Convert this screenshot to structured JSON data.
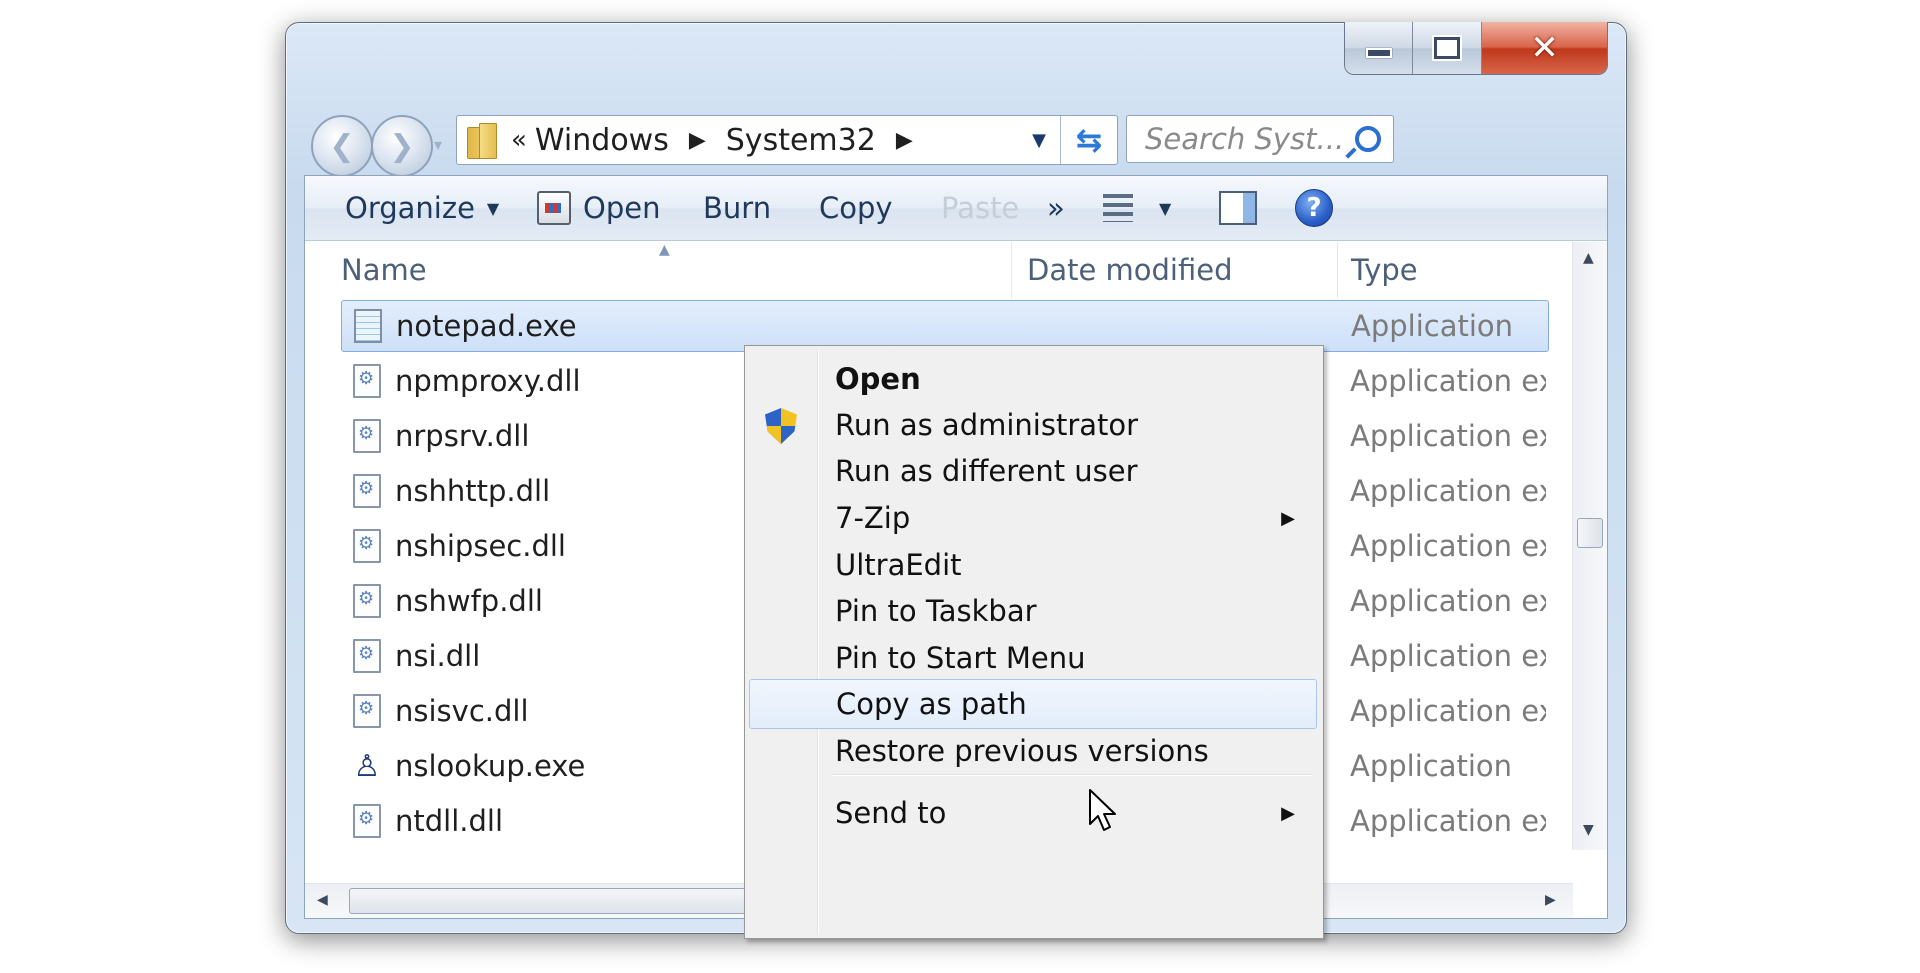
{
  "window": {
    "caption_buttons": {
      "close_glyph": "✕"
    }
  },
  "navigation": {
    "back_glyph": "❮",
    "forward_glyph": "❯",
    "history_glyph": "▾"
  },
  "address_bar": {
    "overflow_glyph": "«",
    "crumbs": [
      "Windows",
      "System32"
    ],
    "crumb_chevron": "▶",
    "dropdown_glyph": "▼",
    "refresh_glyph": "⇆"
  },
  "search": {
    "placeholder": "Search Syst..."
  },
  "toolbar": {
    "organize": "Organize",
    "open": "Open",
    "burn": "Burn",
    "copy": "Copy",
    "paste": "Paste",
    "more": "»",
    "dropdown_glyph": "▼",
    "help_glyph": "?"
  },
  "columns": {
    "name": "Name",
    "date_modified": "Date modified",
    "type": "Type",
    "sort_glyph": "▲"
  },
  "files": [
    {
      "name": "notepad.exe",
      "type": "Application",
      "icon": "notepad-icon",
      "selected": true
    },
    {
      "name": "npmproxy.dll",
      "type": "Application exte",
      "icon": "dll-file-icon"
    },
    {
      "name": "nrpsrv.dll",
      "type": "Application exte",
      "icon": "dll-file-icon"
    },
    {
      "name": "nshhttp.dll",
      "type": "Application exte",
      "icon": "dll-file-icon"
    },
    {
      "name": "nshipsec.dll",
      "type": "Application exte",
      "icon": "dll-file-icon"
    },
    {
      "name": "nshwfp.dll",
      "type": "Application exte",
      "icon": "dll-file-icon"
    },
    {
      "name": "nsi.dll",
      "type": "Application exte",
      "icon": "dll-file-icon"
    },
    {
      "name": "nsisvc.dll",
      "type": "Application exte",
      "icon": "dll-file-icon"
    },
    {
      "name": "nslookup.exe",
      "type": "Application",
      "icon": "network-app-icon"
    },
    {
      "name": "ntdll.dll",
      "type": "Application exte",
      "icon": "dll-file-icon"
    }
  ],
  "scrollbars": {
    "up_glyph": "▲",
    "down_glyph": "▼",
    "left_glyph": "◀",
    "right_glyph": "▶"
  },
  "context_menu": {
    "items": [
      {
        "label": "Open",
        "bold": true
      },
      {
        "label": "Run as administrator",
        "icon": "uac-shield-icon"
      },
      {
        "label": "Run as different user"
      },
      {
        "label": "7-Zip",
        "submenu": true
      },
      {
        "label": "UltraEdit"
      },
      {
        "label": "Pin to Taskbar"
      },
      {
        "label": "Pin to Start Menu"
      },
      {
        "label": "Copy as path",
        "hovered": true
      },
      {
        "label": "Restore previous versions"
      },
      {
        "label": "Send to",
        "submenu": true
      }
    ],
    "submenu_glyph": "▶"
  }
}
